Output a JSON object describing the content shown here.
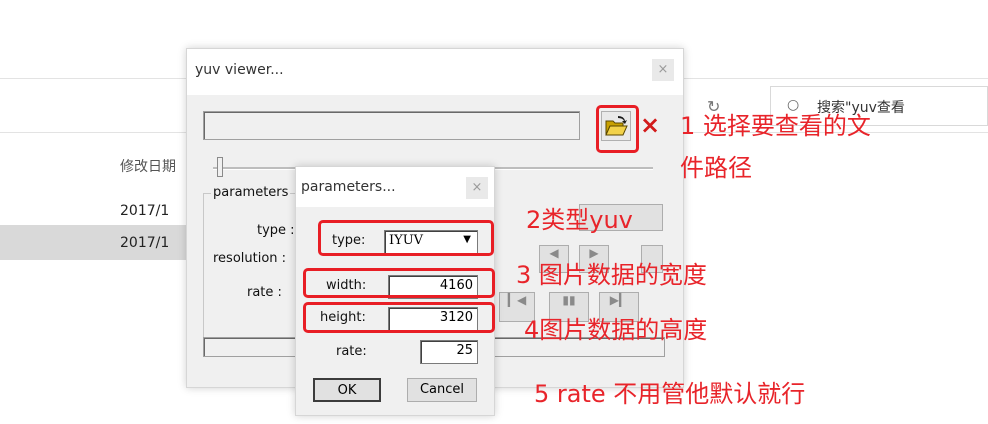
{
  "explorer": {
    "column_header": "修改日期",
    "rows": [
      "2017/1",
      "2017/1"
    ],
    "search_placeholder": "搜索\"yuv查看"
  },
  "yuv_viewer": {
    "title": "yuv viewer...",
    "close_glyph": "×",
    "file_path": "",
    "params_group_label": "parameters",
    "type_label": "type :",
    "resolution_label": "resolution :",
    "rate_label": "rate :"
  },
  "parameters_dialog": {
    "title": "parameters...",
    "close_glyph": "×",
    "type_label": "type:",
    "type_value": "IYUV",
    "width_label": "width:",
    "width_value": "4160",
    "height_label": "height:",
    "height_value": "3120",
    "rate_label": "rate:",
    "rate_value": "25",
    "ok_label": "OK",
    "cancel_label": "Cancel"
  },
  "annotations": {
    "a1_line1": "1 选择要查看的文",
    "a1_line2": "件路径",
    "a2": "2类型yuv",
    "a3": "3 图片数据的宽度",
    "a4": "4图片数据的高度",
    "a5": "5 rate 不用管他默认就行"
  },
  "colors": {
    "annotation": "#e8242a",
    "dialog_bg": "#f0f0f0"
  }
}
